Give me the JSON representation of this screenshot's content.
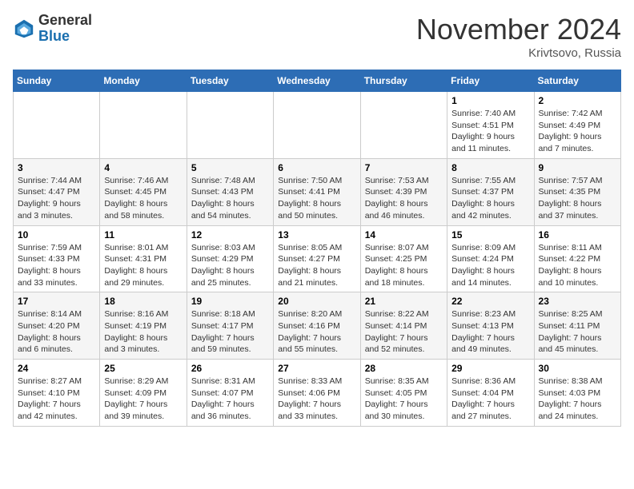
{
  "logo": {
    "general": "General",
    "blue": "Blue"
  },
  "title": "November 2024",
  "location": "Krivtsovo, Russia",
  "days_header": [
    "Sunday",
    "Monday",
    "Tuesday",
    "Wednesday",
    "Thursday",
    "Friday",
    "Saturday"
  ],
  "weeks": [
    [
      {
        "day": "",
        "info": ""
      },
      {
        "day": "",
        "info": ""
      },
      {
        "day": "",
        "info": ""
      },
      {
        "day": "",
        "info": ""
      },
      {
        "day": "",
        "info": ""
      },
      {
        "day": "1",
        "info": "Sunrise: 7:40 AM\nSunset: 4:51 PM\nDaylight: 9 hours and 11 minutes."
      },
      {
        "day": "2",
        "info": "Sunrise: 7:42 AM\nSunset: 4:49 PM\nDaylight: 9 hours and 7 minutes."
      }
    ],
    [
      {
        "day": "3",
        "info": "Sunrise: 7:44 AM\nSunset: 4:47 PM\nDaylight: 9 hours and 3 minutes."
      },
      {
        "day": "4",
        "info": "Sunrise: 7:46 AM\nSunset: 4:45 PM\nDaylight: 8 hours and 58 minutes."
      },
      {
        "day": "5",
        "info": "Sunrise: 7:48 AM\nSunset: 4:43 PM\nDaylight: 8 hours and 54 minutes."
      },
      {
        "day": "6",
        "info": "Sunrise: 7:50 AM\nSunset: 4:41 PM\nDaylight: 8 hours and 50 minutes."
      },
      {
        "day": "7",
        "info": "Sunrise: 7:53 AM\nSunset: 4:39 PM\nDaylight: 8 hours and 46 minutes."
      },
      {
        "day": "8",
        "info": "Sunrise: 7:55 AM\nSunset: 4:37 PM\nDaylight: 8 hours and 42 minutes."
      },
      {
        "day": "9",
        "info": "Sunrise: 7:57 AM\nSunset: 4:35 PM\nDaylight: 8 hours and 37 minutes."
      }
    ],
    [
      {
        "day": "10",
        "info": "Sunrise: 7:59 AM\nSunset: 4:33 PM\nDaylight: 8 hours and 33 minutes."
      },
      {
        "day": "11",
        "info": "Sunrise: 8:01 AM\nSunset: 4:31 PM\nDaylight: 8 hours and 29 minutes."
      },
      {
        "day": "12",
        "info": "Sunrise: 8:03 AM\nSunset: 4:29 PM\nDaylight: 8 hours and 25 minutes."
      },
      {
        "day": "13",
        "info": "Sunrise: 8:05 AM\nSunset: 4:27 PM\nDaylight: 8 hours and 21 minutes."
      },
      {
        "day": "14",
        "info": "Sunrise: 8:07 AM\nSunset: 4:25 PM\nDaylight: 8 hours and 18 minutes."
      },
      {
        "day": "15",
        "info": "Sunrise: 8:09 AM\nSunset: 4:24 PM\nDaylight: 8 hours and 14 minutes."
      },
      {
        "day": "16",
        "info": "Sunrise: 8:11 AM\nSunset: 4:22 PM\nDaylight: 8 hours and 10 minutes."
      }
    ],
    [
      {
        "day": "17",
        "info": "Sunrise: 8:14 AM\nSunset: 4:20 PM\nDaylight: 8 hours and 6 minutes."
      },
      {
        "day": "18",
        "info": "Sunrise: 8:16 AM\nSunset: 4:19 PM\nDaylight: 8 hours and 3 minutes."
      },
      {
        "day": "19",
        "info": "Sunrise: 8:18 AM\nSunset: 4:17 PM\nDaylight: 7 hours and 59 minutes."
      },
      {
        "day": "20",
        "info": "Sunrise: 8:20 AM\nSunset: 4:16 PM\nDaylight: 7 hours and 55 minutes."
      },
      {
        "day": "21",
        "info": "Sunrise: 8:22 AM\nSunset: 4:14 PM\nDaylight: 7 hours and 52 minutes."
      },
      {
        "day": "22",
        "info": "Sunrise: 8:23 AM\nSunset: 4:13 PM\nDaylight: 7 hours and 49 minutes."
      },
      {
        "day": "23",
        "info": "Sunrise: 8:25 AM\nSunset: 4:11 PM\nDaylight: 7 hours and 45 minutes."
      }
    ],
    [
      {
        "day": "24",
        "info": "Sunrise: 8:27 AM\nSunset: 4:10 PM\nDaylight: 7 hours and 42 minutes."
      },
      {
        "day": "25",
        "info": "Sunrise: 8:29 AM\nSunset: 4:09 PM\nDaylight: 7 hours and 39 minutes."
      },
      {
        "day": "26",
        "info": "Sunrise: 8:31 AM\nSunset: 4:07 PM\nDaylight: 7 hours and 36 minutes."
      },
      {
        "day": "27",
        "info": "Sunrise: 8:33 AM\nSunset: 4:06 PM\nDaylight: 7 hours and 33 minutes."
      },
      {
        "day": "28",
        "info": "Sunrise: 8:35 AM\nSunset: 4:05 PM\nDaylight: 7 hours and 30 minutes."
      },
      {
        "day": "29",
        "info": "Sunrise: 8:36 AM\nSunset: 4:04 PM\nDaylight: 7 hours and 27 minutes."
      },
      {
        "day": "30",
        "info": "Sunrise: 8:38 AM\nSunset: 4:03 PM\nDaylight: 7 hours and 24 minutes."
      }
    ]
  ]
}
